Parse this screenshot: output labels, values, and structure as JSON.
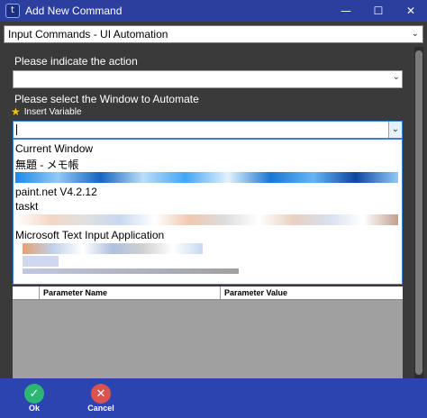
{
  "window": {
    "title": "Add New Command",
    "app_icon_glyph": "t"
  },
  "window_controls": {
    "minimize": "—",
    "maximize": "☐",
    "close": "✕"
  },
  "category": {
    "selected": "Input Commands - UI Automation"
  },
  "action": {
    "label": "Please indicate the action",
    "value": ""
  },
  "window_select": {
    "label": "Please select the Window to Automate",
    "insert_variable": "Insert Variable",
    "value": "",
    "options": [
      "Current Window",
      "無題 - メモ帳",
      "paint.net V4.2.12",
      "taskt",
      "Microsoft Text Input Application"
    ]
  },
  "parameter_grid": {
    "columns": [
      "",
      "Parameter Name",
      "Parameter Value"
    ]
  },
  "footer": {
    "ok_label": "Ok",
    "cancel_label": "Cancel"
  },
  "colors": {
    "titlebar": "#2a3f9e",
    "footer": "#2b44b0",
    "ok": "#2bb673",
    "cancel": "#d9534f",
    "star": "#f5c400"
  }
}
